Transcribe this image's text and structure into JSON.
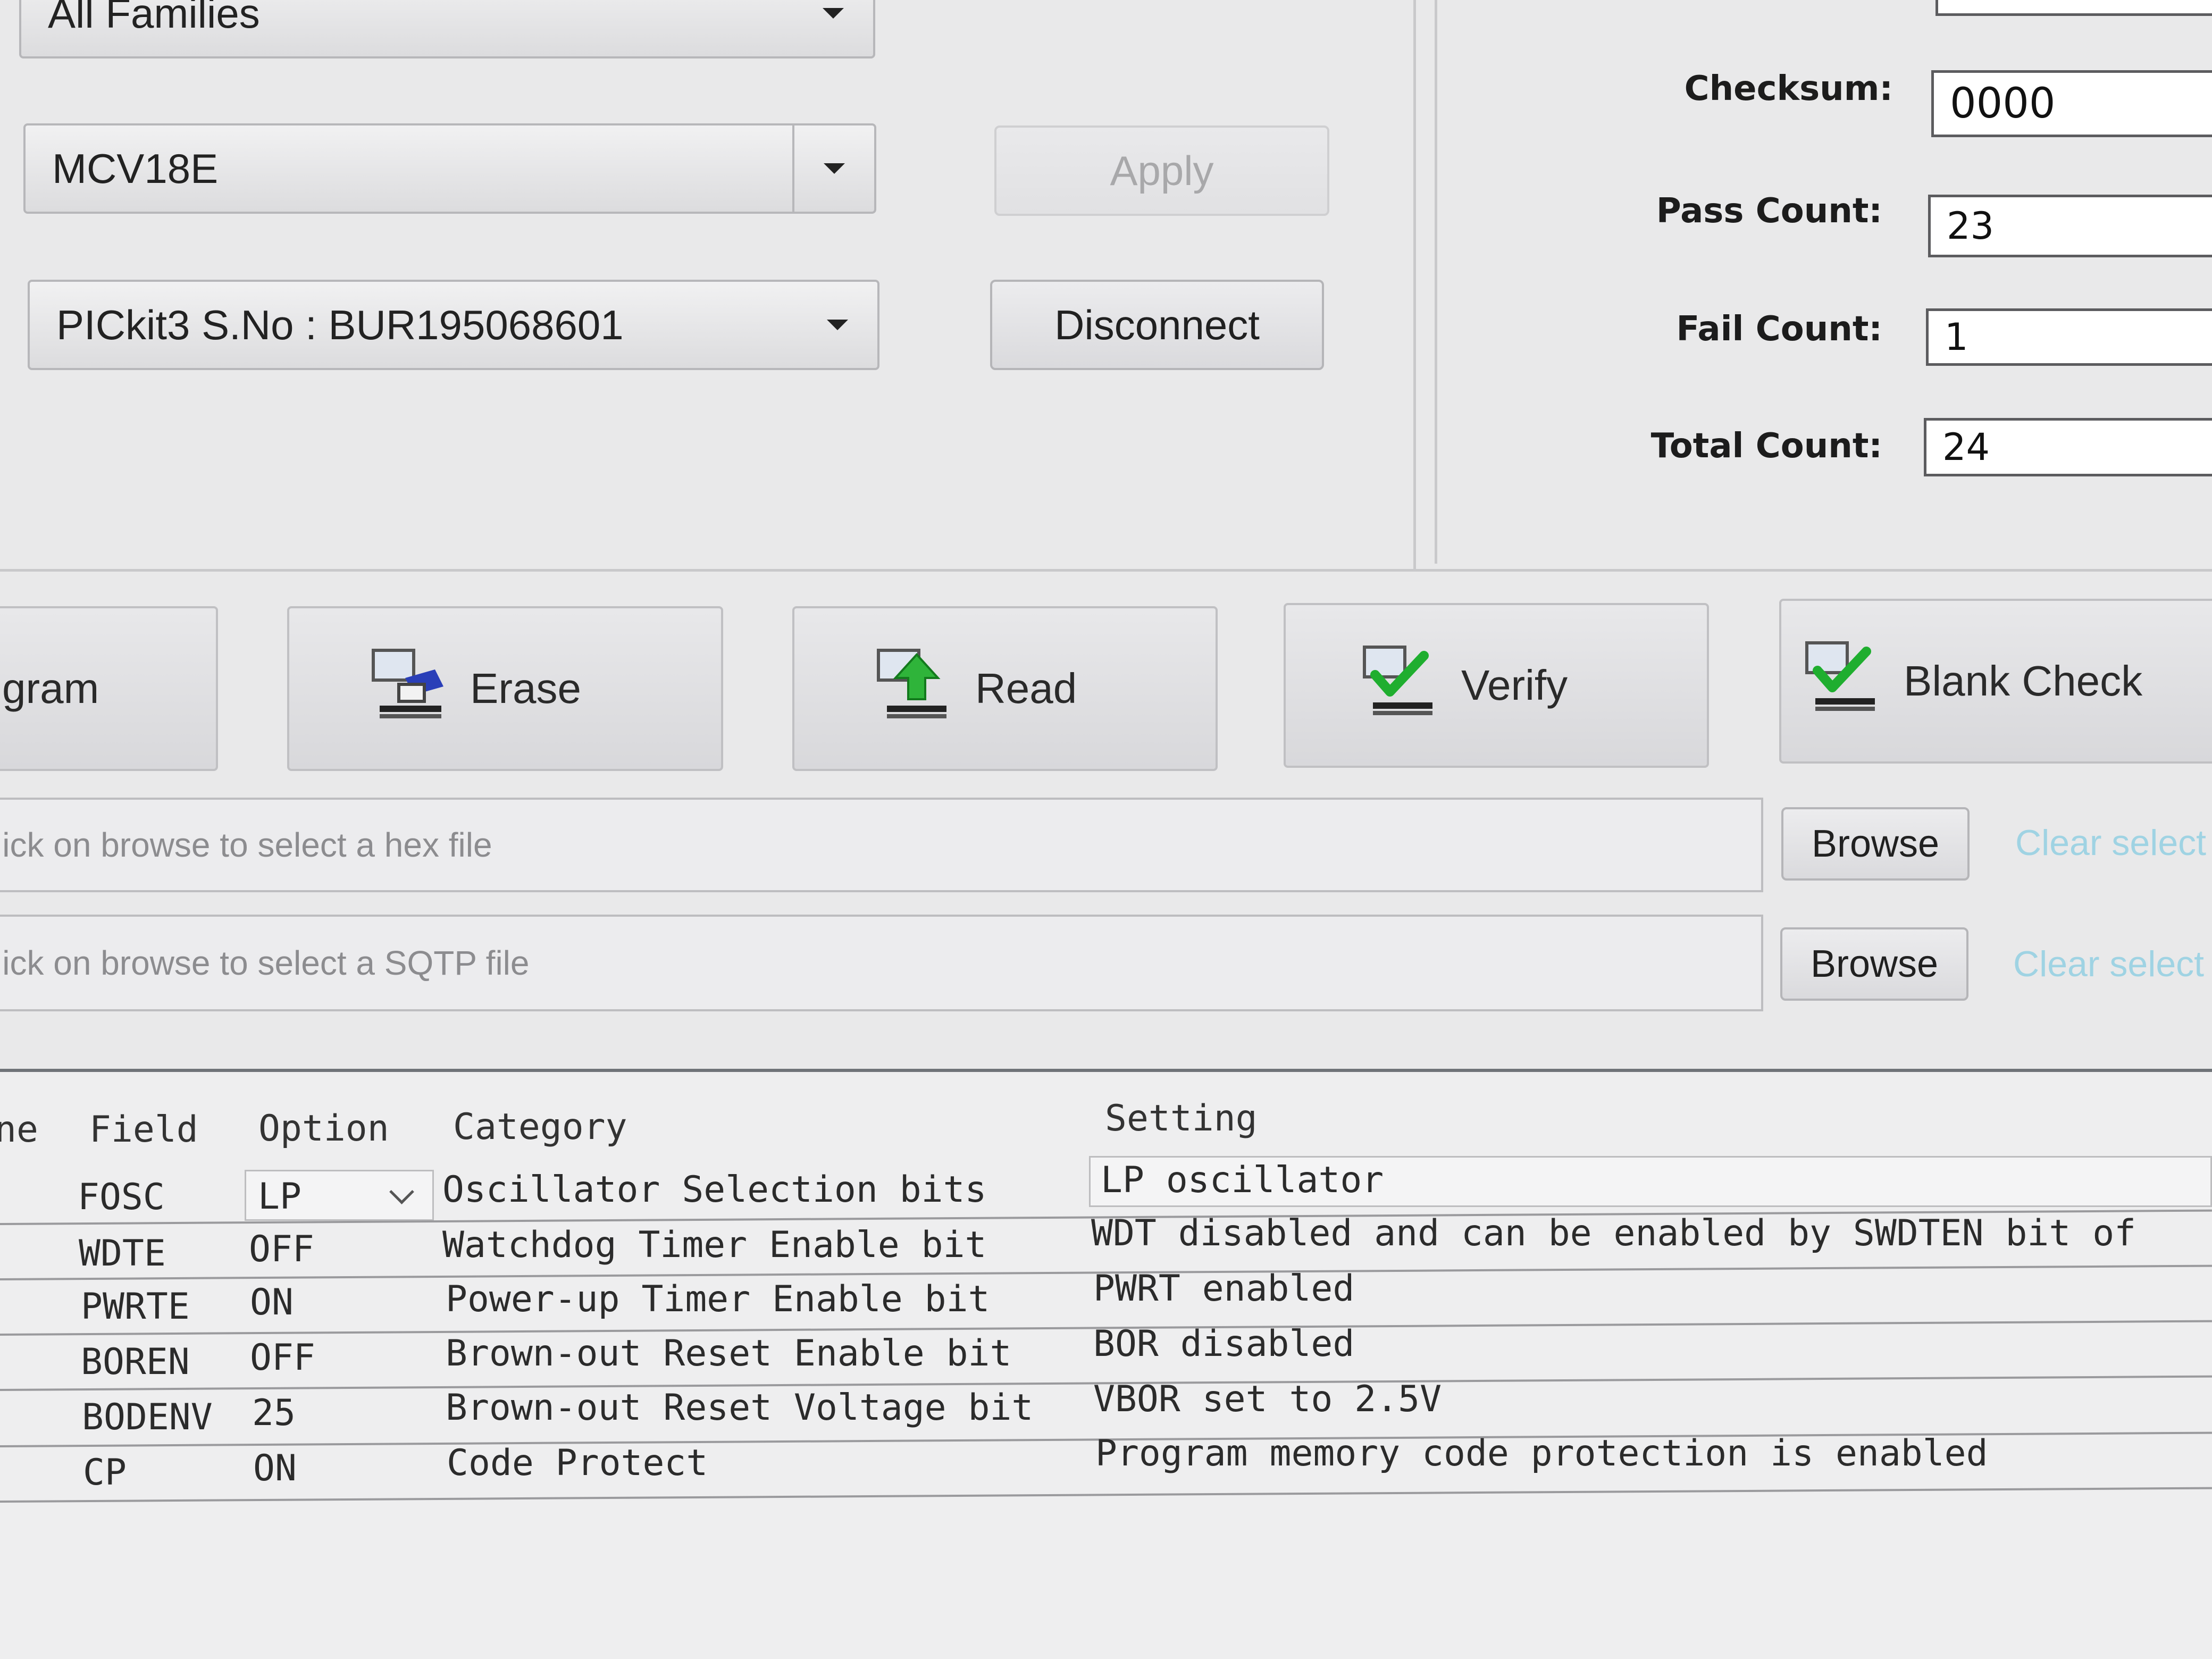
{
  "device": {
    "family": "All Families",
    "part": "MCV18E",
    "apply_label": "Apply",
    "programmer": "PICkit3 S.No : BUR195068601",
    "disconnect_label": "Disconnect"
  },
  "stats": {
    "checksum_label": "Checksum:",
    "checksum_value": "0000",
    "pass_label": "Pass Count:",
    "pass_value": "23",
    "fail_label": "Fail Count:",
    "fail_value": "1",
    "total_label": "Total Count:",
    "total_value": "24"
  },
  "actions": {
    "program": "gram",
    "erase": "Erase",
    "read": "Read",
    "verify": "Verify",
    "blank_check": "Blank Check"
  },
  "files": {
    "hex_placeholder": "lick on browse to select a hex file",
    "sqtp_placeholder": "lick on browse to select a SQTP file",
    "browse_label": "Browse",
    "clear_label": "Clear select"
  },
  "config": {
    "headers": {
      "name": "ne",
      "field": "Field",
      "option": "Option",
      "category": "Category",
      "setting": "Setting"
    },
    "rows": [
      {
        "field": "FOSC",
        "option": "LP",
        "category": "Oscillator Selection bits",
        "setting": "LP oscillator"
      },
      {
        "field": "WDTE",
        "option": "OFF",
        "category": "Watchdog Timer Enable bit",
        "setting": "WDT disabled and can be enabled by SWDTEN bit of"
      },
      {
        "field": "PWRTE",
        "option": "ON",
        "category": "Power-up Timer Enable bit",
        "setting": "PWRT enabled"
      },
      {
        "field": "BOREN",
        "option": "OFF",
        "category": "Brown-out Reset Enable bit",
        "setting": "BOR disabled"
      },
      {
        "field": "BODENV",
        "option": "25",
        "category": "Brown-out Reset Voltage bit",
        "setting": "VBOR set to 2.5V"
      },
      {
        "field": "CP",
        "option": "ON",
        "category": "Code Protect",
        "setting": "Program memory code protection is enabled"
      }
    ]
  },
  "colors": {
    "background": "#e9e9ea",
    "link": "#9fd3e3",
    "check_green": "#1fae2f",
    "arrow_green": "#2fb43a",
    "chip_blue": "#2a3fb8"
  }
}
